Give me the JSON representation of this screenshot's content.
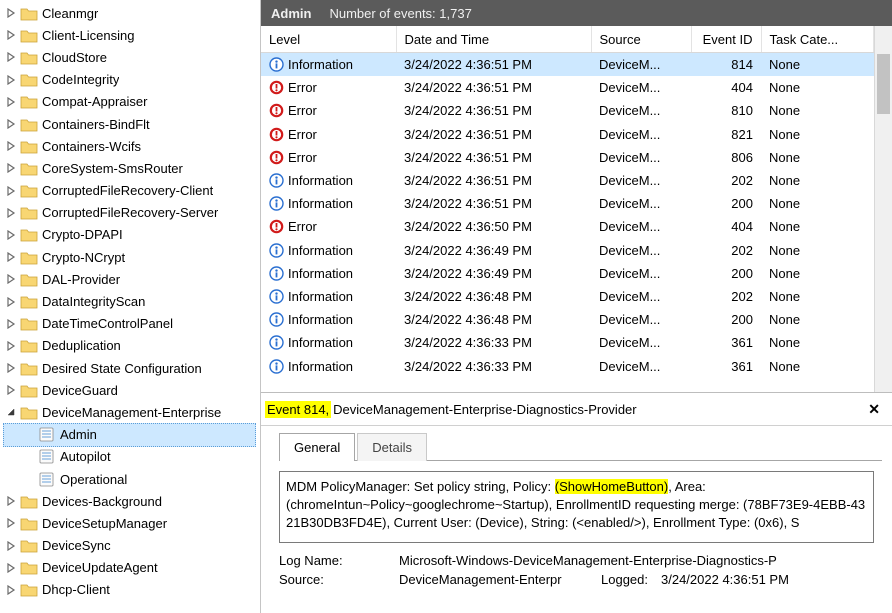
{
  "header": {
    "title": "Admin",
    "count_label": "Number of events: 1,737"
  },
  "tree": [
    {
      "label": "Cleanmgr",
      "depth": 0,
      "exp": "col",
      "icon": "folder"
    },
    {
      "label": "Client-Licensing",
      "depth": 0,
      "exp": "col",
      "icon": "folder"
    },
    {
      "label": "CloudStore",
      "depth": 0,
      "exp": "col",
      "icon": "folder"
    },
    {
      "label": "CodeIntegrity",
      "depth": 0,
      "exp": "col",
      "icon": "folder"
    },
    {
      "label": "Compat-Appraiser",
      "depth": 0,
      "exp": "col",
      "icon": "folder"
    },
    {
      "label": "Containers-BindFlt",
      "depth": 0,
      "exp": "col",
      "icon": "folder"
    },
    {
      "label": "Containers-Wcifs",
      "depth": 0,
      "exp": "col",
      "icon": "folder"
    },
    {
      "label": "CoreSystem-SmsRouter",
      "depth": 0,
      "exp": "col",
      "icon": "folder"
    },
    {
      "label": "CorruptedFileRecovery-Client",
      "depth": 0,
      "exp": "col",
      "icon": "folder"
    },
    {
      "label": "CorruptedFileRecovery-Server",
      "depth": 0,
      "exp": "col",
      "icon": "folder"
    },
    {
      "label": "Crypto-DPAPI",
      "depth": 0,
      "exp": "col",
      "icon": "folder"
    },
    {
      "label": "Crypto-NCrypt",
      "depth": 0,
      "exp": "col",
      "icon": "folder"
    },
    {
      "label": "DAL-Provider",
      "depth": 0,
      "exp": "col",
      "icon": "folder"
    },
    {
      "label": "DataIntegrityScan",
      "depth": 0,
      "exp": "col",
      "icon": "folder"
    },
    {
      "label": "DateTimeControlPanel",
      "depth": 0,
      "exp": "col",
      "icon": "folder"
    },
    {
      "label": "Deduplication",
      "depth": 0,
      "exp": "col",
      "icon": "folder"
    },
    {
      "label": "Desired State Configuration",
      "depth": 0,
      "exp": "col",
      "icon": "folder"
    },
    {
      "label": "DeviceGuard",
      "depth": 0,
      "exp": "col",
      "icon": "folder"
    },
    {
      "label": "DeviceManagement-Enterprise",
      "depth": 0,
      "exp": "exp",
      "icon": "folder"
    },
    {
      "label": "Admin",
      "depth": 1,
      "exp": "none",
      "icon": "log",
      "selected": true
    },
    {
      "label": "Autopilot",
      "depth": 1,
      "exp": "none",
      "icon": "log"
    },
    {
      "label": "Operational",
      "depth": 1,
      "exp": "none",
      "icon": "log"
    },
    {
      "label": "Devices-Background",
      "depth": 0,
      "exp": "col",
      "icon": "folder"
    },
    {
      "label": "DeviceSetupManager",
      "depth": 0,
      "exp": "col",
      "icon": "folder"
    },
    {
      "label": "DeviceSync",
      "depth": 0,
      "exp": "col",
      "icon": "folder"
    },
    {
      "label": "DeviceUpdateAgent",
      "depth": 0,
      "exp": "col",
      "icon": "folder"
    },
    {
      "label": "Dhcp-Client",
      "depth": 0,
      "exp": "col",
      "icon": "folder"
    }
  ],
  "columns": {
    "level": "Level",
    "date": "Date and Time",
    "source": "Source",
    "eventid": "Event ID",
    "task": "Task Cate..."
  },
  "events": [
    {
      "level": "Information",
      "date": "3/24/2022 4:36:51 PM",
      "source": "DeviceM...",
      "id": "814",
      "task": "None",
      "sel": true
    },
    {
      "level": "Error",
      "date": "3/24/2022 4:36:51 PM",
      "source": "DeviceM...",
      "id": "404",
      "task": "None"
    },
    {
      "level": "Error",
      "date": "3/24/2022 4:36:51 PM",
      "source": "DeviceM...",
      "id": "810",
      "task": "None"
    },
    {
      "level": "Error",
      "date": "3/24/2022 4:36:51 PM",
      "source": "DeviceM...",
      "id": "821",
      "task": "None"
    },
    {
      "level": "Error",
      "date": "3/24/2022 4:36:51 PM",
      "source": "DeviceM...",
      "id": "806",
      "task": "None"
    },
    {
      "level": "Information",
      "date": "3/24/2022 4:36:51 PM",
      "source": "DeviceM...",
      "id": "202",
      "task": "None"
    },
    {
      "level": "Information",
      "date": "3/24/2022 4:36:51 PM",
      "source": "DeviceM...",
      "id": "200",
      "task": "None"
    },
    {
      "level": "Error",
      "date": "3/24/2022 4:36:50 PM",
      "source": "DeviceM...",
      "id": "404",
      "task": "None"
    },
    {
      "level": "Information",
      "date": "3/24/2022 4:36:49 PM",
      "source": "DeviceM...",
      "id": "202",
      "task": "None"
    },
    {
      "level": "Information",
      "date": "3/24/2022 4:36:49 PM",
      "source": "DeviceM...",
      "id": "200",
      "task": "None"
    },
    {
      "level": "Information",
      "date": "3/24/2022 4:36:48 PM",
      "source": "DeviceM...",
      "id": "202",
      "task": "None"
    },
    {
      "level": "Information",
      "date": "3/24/2022 4:36:48 PM",
      "source": "DeviceM...",
      "id": "200",
      "task": "None"
    },
    {
      "level": "Information",
      "date": "3/24/2022 4:36:33 PM",
      "source": "DeviceM...",
      "id": "361",
      "task": "None"
    },
    {
      "level": "Information",
      "date": "3/24/2022 4:36:33 PM",
      "source": "DeviceM...",
      "id": "361",
      "task": "None"
    }
  ],
  "detail": {
    "header_event": "Event 814,",
    "header_provider": " DeviceManagement-Enterprise-Diagnostics-Provider",
    "close": "✕",
    "tab_general": "General",
    "tab_details": "Details",
    "msg_pre": "MDM PolicyManager: Set policy string, Policy: ",
    "msg_hl": "(ShowHomeButton)",
    "msg_post": ", Area: (chromeIntun~Policy~googlechrome~Startup), EnrollmentID requesting merge: (78BF73E9-4EBB-43 21B30DB3FD4E), Current User: (Device), String: (<enabled/>), Enrollment Type: (0x6), S",
    "logname_k": "Log Name:",
    "logname_v": "Microsoft-Windows-DeviceManagement-Enterprise-Diagnostics-P",
    "source_k": "Source:",
    "source_v": "DeviceManagement-Enterpr",
    "logged_k": "Logged:",
    "logged_v": "3/24/2022 4:36:51 PM"
  }
}
